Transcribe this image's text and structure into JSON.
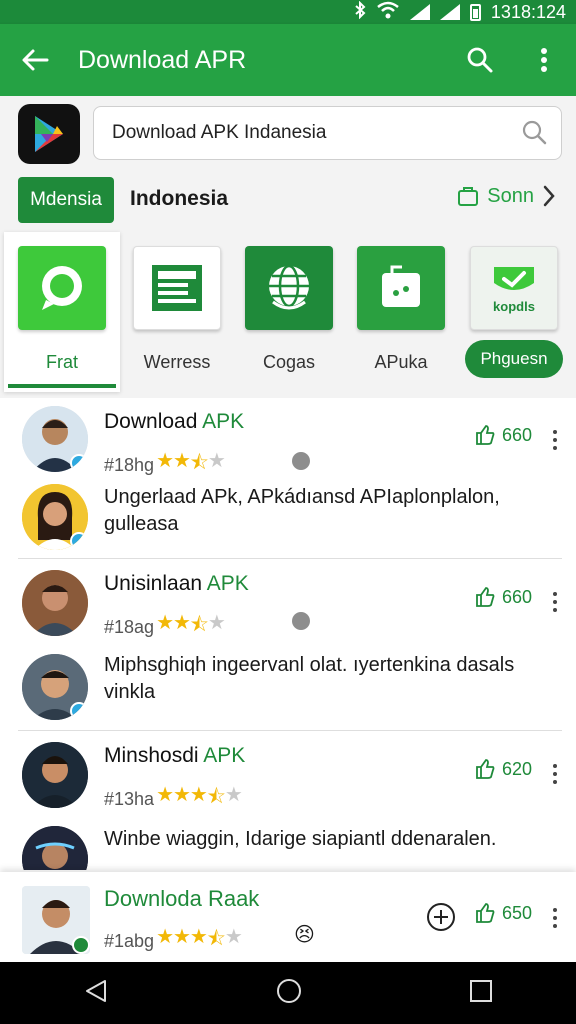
{
  "status_bar": {
    "time": "1318:124"
  },
  "app_bar": {
    "title": "Download APR"
  },
  "search": {
    "value": "Download APK Indanesia"
  },
  "region": {
    "chip_label": "Mdensia",
    "name": "Indonesia",
    "save_label": "Sonn"
  },
  "categories": [
    {
      "label": "Frat",
      "icon": "chat-bubble-icon",
      "color": "#3ec93b",
      "active": true
    },
    {
      "label": "Werress",
      "icon": "document-icon",
      "color": "#ffffff"
    },
    {
      "label": "Cogas",
      "icon": "globe-icon",
      "color": "#1f8a3a"
    },
    {
      "label": "APuka",
      "icon": "bag-icon",
      "color": "#2aa040"
    },
    {
      "label": "Phguesn",
      "icon": "shield-check-icon",
      "color": "#eef3ee"
    }
  ],
  "category_extra_tile_label": "kopdls",
  "list": [
    {
      "name": "Download",
      "tag": "APK",
      "meta": "#18hg",
      "rating": 2.5,
      "likes": "660",
      "desc": "Ungerlaad APk, APkádıansd APIaplonplalon, gulleasa"
    },
    {
      "name": "Unisinlaan",
      "tag": "APK",
      "meta": "#18ag",
      "rating": 2.5,
      "likes": "660",
      "desc": "Miphsghiqh ingeervanl olat. ıyertenkina dasals vinkla"
    },
    {
      "name": "Minshosdi",
      "tag": "APK",
      "meta": "#13ha",
      "rating": 3.5,
      "likes": "620",
      "desc": "Winbe wiaggin, Idarige siapiantl ddenaralen."
    }
  ],
  "bottom_item": {
    "name": "Downloda Raak",
    "meta": "#1abg",
    "rating": 3.5,
    "likes": "650"
  },
  "colors": {
    "primary": "#25a244",
    "primary_dark": "#1f8a3a",
    "status_bar": "#1c8a3a",
    "star": "#f2b807"
  }
}
